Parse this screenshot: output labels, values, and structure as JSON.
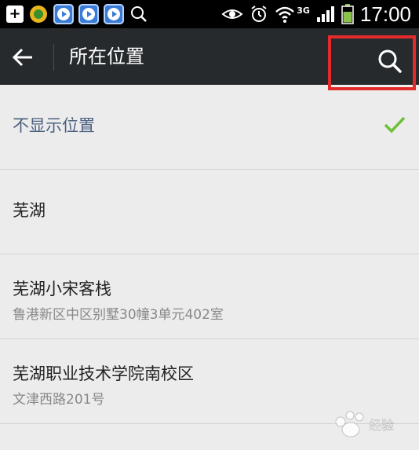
{
  "status_bar": {
    "time": "17:00",
    "network": "3G",
    "icons": [
      "plus-notification-icon",
      "app-notification-icon",
      "video-player-icon",
      "video-player-icon",
      "video-player-icon",
      "search-notification-icon",
      "eye-icon",
      "alarm-icon",
      "wifi-icon",
      "signal-icon",
      "battery-icon"
    ]
  },
  "app_bar": {
    "title": "所在位置",
    "back_icon": "arrow-left-icon",
    "search_icon": "search-icon",
    "highlight_color": "#e32b2b"
  },
  "locations": [
    {
      "name": "不显示位置",
      "address": "",
      "selected": true
    },
    {
      "name": "芜湖",
      "address": "",
      "selected": false
    },
    {
      "name": "芜湖小宋客栈",
      "address": "鲁港新区中区别墅30幢3单元402室",
      "selected": false
    },
    {
      "name": "芜湖职业技术学院南校区",
      "address": "文津西路201号",
      "selected": false
    }
  ],
  "colors": {
    "check": "#6fbf3a",
    "selected_text": "#4d6080",
    "app_bar_bg": "#262a2d"
  }
}
